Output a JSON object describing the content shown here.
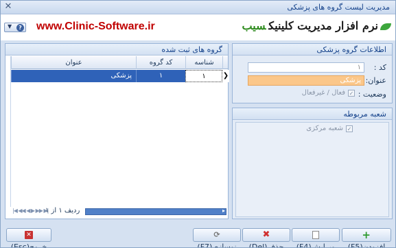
{
  "window": {
    "title": "مدیریت لیست گروه های پزشکی",
    "close_glyph": "✕"
  },
  "header": {
    "logo_text": "نرم افزار مدیریت کلینیک",
    "logo_brand": "سیب",
    "website": "www.Clinic-Software.ir"
  },
  "grid": {
    "caption": "گروه های ثبت شده",
    "columns": [
      "شناسه",
      "کد گروه",
      "عنوان"
    ],
    "rows": [
      {
        "id": "۱",
        "code": "۱",
        "title": "پزشکی"
      }
    ],
    "row_indicator": "❯",
    "nav_text": "ردیف ۱ از ۱"
  },
  "info": {
    "caption": "اطلاعات گروه پزشکی",
    "code_label": "کد :",
    "code_value": "۱",
    "title_label": "عنوان:",
    "title_value": "پزشکی",
    "status_label": "وضعیت :",
    "status_checkbox_label": "فعال / غیرفعال",
    "status_checked": true
  },
  "branch": {
    "caption": "شعبه مربوطه",
    "items": [
      {
        "label": "شعبه مرکزی",
        "checked": true
      }
    ]
  },
  "buttons": {
    "add": "افزودن(F5)",
    "edit": "ویرایش(F4)",
    "delete": "حذف(Del)",
    "refresh": "نوسازی(F7)",
    "exit": "خروج(Esc)"
  },
  "colors": {
    "selection": "#2f62b8",
    "highlight_field": "#fbc78a",
    "website": "#c00000",
    "brand": "#2e8b1e"
  }
}
